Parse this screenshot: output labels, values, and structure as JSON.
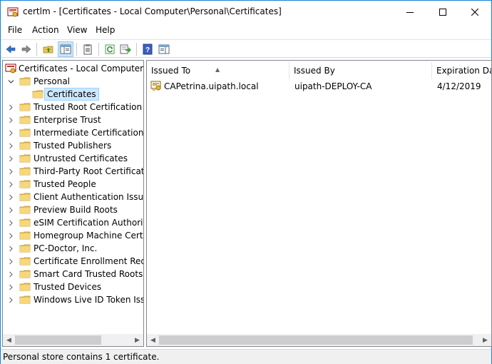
{
  "window": {
    "title": "certlm - [Certificates - Local Computer\\Personal\\Certificates]"
  },
  "menu": [
    "File",
    "Action",
    "View",
    "Help"
  ],
  "toolbar": {
    "buttons": [
      {
        "icon": "back-arrow-icon"
      },
      {
        "icon": "forward-arrow-icon"
      },
      {
        "icon": "up-folder-icon"
      },
      {
        "icon": "show-hide-console-tree-icon"
      },
      {
        "icon": "properties-icon"
      },
      {
        "icon": "refresh-icon"
      },
      {
        "icon": "export-list-icon"
      },
      {
        "icon": "help-icon"
      },
      {
        "icon": "action-pane-icon"
      }
    ]
  },
  "tree": {
    "root": "Certificates - Local Computer",
    "personal": "Personal",
    "selected": "Certificates",
    "stores": [
      "Trusted Root Certification Authorities",
      "Enterprise Trust",
      "Intermediate Certification Authorities",
      "Trusted Publishers",
      "Untrusted Certificates",
      "Third-Party Root Certification Authorities",
      "Trusted People",
      "Client Authentication Issuers",
      "Preview Build Roots",
      "eSIM Certification Authorities",
      "Homegroup Machine Certificates",
      "PC-Doctor, Inc.",
      "Certificate Enrollment Requests",
      "Smart Card Trusted Roots",
      "Trusted Devices",
      "Windows Live ID Token Issuer"
    ]
  },
  "list": {
    "columns": [
      "Issued To",
      "Issued By",
      "Expiration Date"
    ],
    "rows": [
      {
        "issued_to": "CAPetrina.uipath.local",
        "issued_by": "uipath-DEPLOY-CA",
        "expiration": "4/12/2019"
      }
    ]
  },
  "status": "Personal store contains 1 certificate.",
  "colors": {
    "accent": "#1883d7",
    "selection": "#cce8ff",
    "folder": "#e8c25a"
  }
}
